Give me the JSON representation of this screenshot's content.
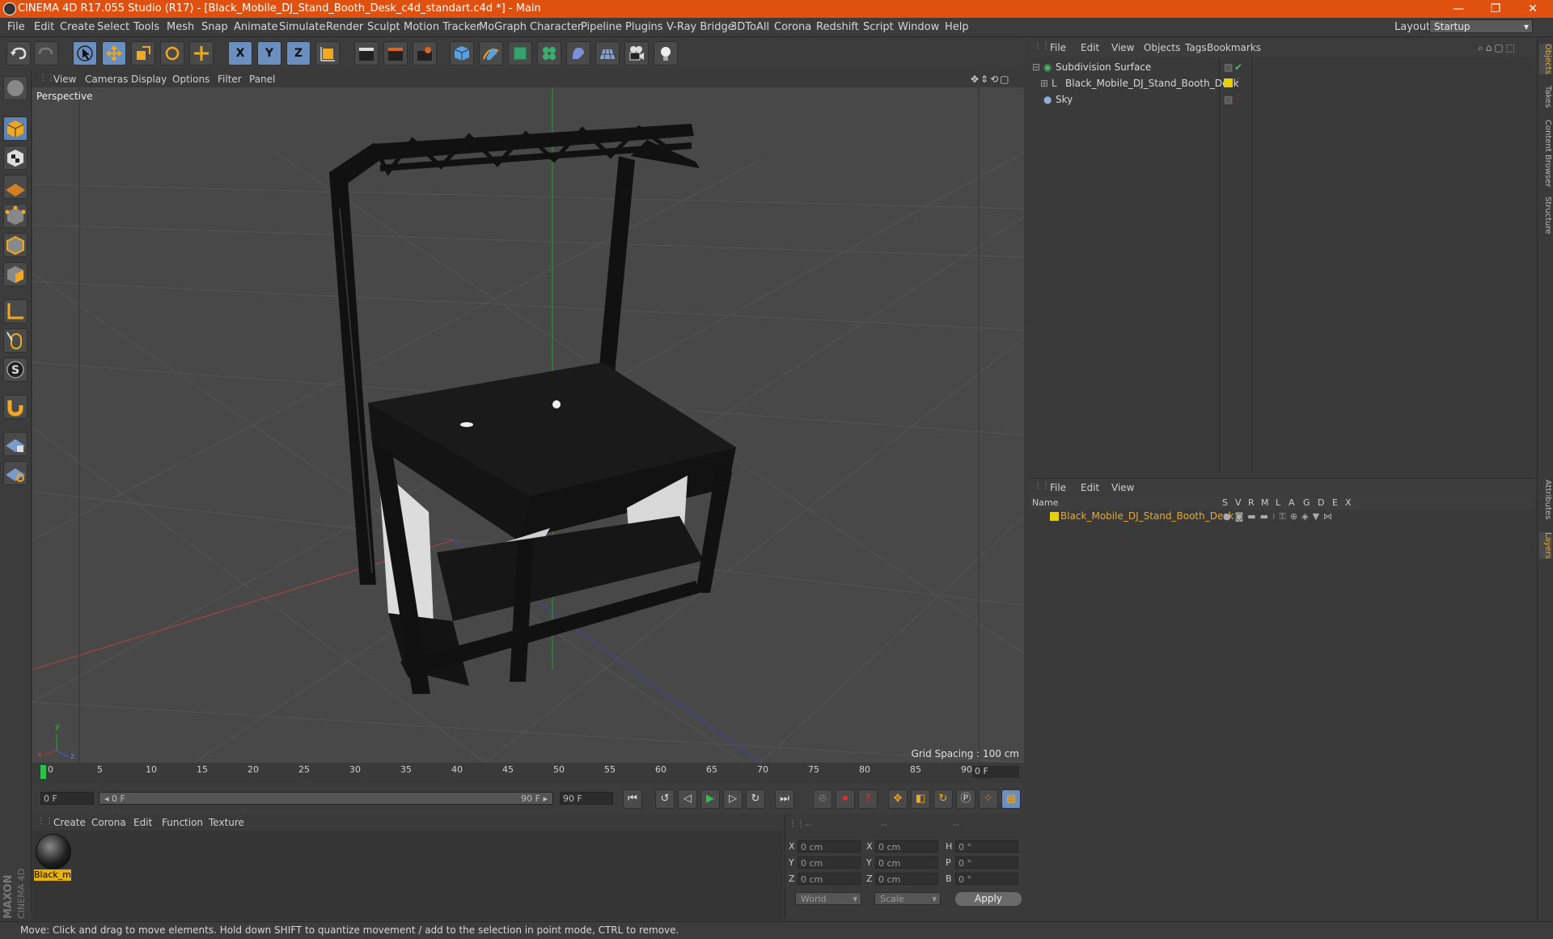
{
  "window": {
    "title": "CINEMA 4D R17.055 Studio (R17) - [Black_Mobile_DJ_Stand_Booth_Desk_c4d_standart.c4d *] - Main",
    "minimize": "—",
    "restore": "❐",
    "close": "✕"
  },
  "menubar": {
    "items": [
      "File",
      "Edit",
      "Create",
      "Select",
      "Tools",
      "Mesh",
      "Snap",
      "Animate",
      "Simulate",
      "Render",
      "Sculpt",
      "Motion Tracker",
      "MoGraph",
      "Character",
      "Pipeline",
      "Plugins",
      "V-Ray Bridge",
      "3DToAll",
      "Corona",
      "Redshift",
      "Script",
      "Window",
      "Help"
    ],
    "layout_label": "Layout:",
    "layout_value": "Startup"
  },
  "toolbar": {
    "axis_x": "X",
    "axis_y": "Y",
    "axis_z": "Z"
  },
  "viewport": {
    "menu": [
      "View",
      "Cameras",
      "Display",
      "Options",
      "Filter",
      "Panel"
    ],
    "camera_label": "Perspective",
    "grid_spacing": "Grid Spacing : 100 cm",
    "axis_y": "y",
    "axis_z": "z",
    "axis_x": "x"
  },
  "timeline": {
    "ticks": [
      "0",
      "5",
      "10",
      "15",
      "20",
      "25",
      "30",
      "35",
      "40",
      "45",
      "50",
      "55",
      "60",
      "65",
      "70",
      "75",
      "80",
      "85",
      "90"
    ],
    "current_frame": "0 F"
  },
  "transport": {
    "start_field": "0 F",
    "range_start": "◂ 0 F",
    "range_end": "90 F ▸",
    "end_field": "90 F"
  },
  "material_manager": {
    "menu": [
      "Create",
      "Corona",
      "Edit",
      "Function",
      "Texture"
    ],
    "material_name": "Black_m"
  },
  "coordinates": {
    "header_dashes": [
      "--",
      "--",
      "--"
    ],
    "rows": [
      {
        "pos_label": "X",
        "pos": "0 cm",
        "size_label": "X",
        "size": "0 cm",
        "rot_label": "H",
        "rot": "0 °"
      },
      {
        "pos_label": "Y",
        "pos": "0 cm",
        "size_label": "Y",
        "size": "0 cm",
        "rot_label": "P",
        "rot": "0 °"
      },
      {
        "pos_label": "Z",
        "pos": "0 cm",
        "size_label": "Z",
        "size": "0 cm",
        "rot_label": "B",
        "rot": "0 °"
      }
    ],
    "space": "World",
    "mode": "Scale",
    "apply": "Apply"
  },
  "object_manager": {
    "menu": [
      "File",
      "Edit",
      "View",
      "Objects",
      "Tags",
      "Bookmarks"
    ],
    "objects": [
      {
        "name": "Subdivision Surface"
      },
      {
        "name": "Black_Mobile_DJ_Stand_Booth_Desk"
      },
      {
        "name": "Sky"
      }
    ]
  },
  "layer_manager": {
    "menu": [
      "File",
      "Edit",
      "View"
    ],
    "columns": [
      "Name",
      "S",
      "V",
      "R",
      "M",
      "L",
      "A",
      "G",
      "D",
      "E",
      "X"
    ],
    "layers": [
      {
        "name": "Black_Mobile_DJ_Stand_Booth_Desk"
      }
    ]
  },
  "side_tabs": [
    "Objects",
    "Takes",
    "Content Browser",
    "Structure",
    "Attributes",
    "Layers"
  ],
  "status": {
    "text": "Move: Click and drag to move elements. Hold down SHIFT to quantize movement / add to the selection in point mode, CTRL to remove."
  },
  "brand": {
    "maxon": "MAXON",
    "product": "CINEMA 4D"
  },
  "colors": {
    "titlebar": "#e0500e",
    "accent_orange": "#f0a820",
    "selected_blue": "#6a8fbf"
  }
}
